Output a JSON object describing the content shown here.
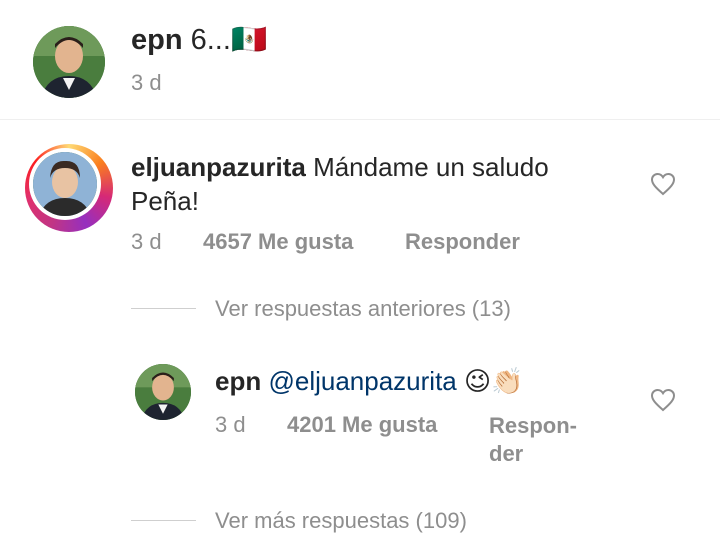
{
  "post": {
    "username": "epn",
    "caption": "6...",
    "flag": "🇲🇽",
    "time": "3 d"
  },
  "comment": {
    "username": "eljuanpazurita",
    "text_line1": "Mándame un saludo",
    "text_line2": "Peña!",
    "time": "3 d",
    "likes": "4657 Me gusta",
    "reply": "Responder"
  },
  "view_previous": "Ver respuestas anteriores (13)",
  "reply": {
    "username": "epn",
    "mention": "@eljuanpazurita",
    "emojis": "😉👏🏻",
    "time": "3 d",
    "likes": "4201 Me gusta",
    "reply_line1": "Respon-",
    "reply_line2": "der"
  },
  "view_more": "Ver más respuestas (109)",
  "icons": {
    "like": "heart-outline-icon"
  },
  "colors": {
    "mention": "#003569",
    "meta": "#8e8e8e",
    "text": "#262626"
  }
}
